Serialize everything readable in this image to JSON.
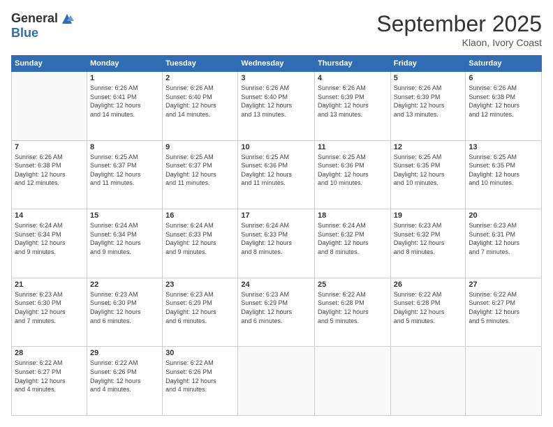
{
  "logo": {
    "general": "General",
    "blue": "Blue"
  },
  "header": {
    "month": "September 2025",
    "location": "Klaon, Ivory Coast"
  },
  "days_of_week": [
    "Sunday",
    "Monday",
    "Tuesday",
    "Wednesday",
    "Thursday",
    "Friday",
    "Saturday"
  ],
  "weeks": [
    [
      {
        "day": "",
        "info": ""
      },
      {
        "day": "1",
        "info": "Sunrise: 6:26 AM\nSunset: 6:41 PM\nDaylight: 12 hours\nand 14 minutes."
      },
      {
        "day": "2",
        "info": "Sunrise: 6:26 AM\nSunset: 6:40 PM\nDaylight: 12 hours\nand 14 minutes."
      },
      {
        "day": "3",
        "info": "Sunrise: 6:26 AM\nSunset: 6:40 PM\nDaylight: 12 hours\nand 13 minutes."
      },
      {
        "day": "4",
        "info": "Sunrise: 6:26 AM\nSunset: 6:39 PM\nDaylight: 12 hours\nand 13 minutes."
      },
      {
        "day": "5",
        "info": "Sunrise: 6:26 AM\nSunset: 6:39 PM\nDaylight: 12 hours\nand 13 minutes."
      },
      {
        "day": "6",
        "info": "Sunrise: 6:26 AM\nSunset: 6:38 PM\nDaylight: 12 hours\nand 12 minutes."
      }
    ],
    [
      {
        "day": "7",
        "info": "Sunrise: 6:26 AM\nSunset: 6:38 PM\nDaylight: 12 hours\nand 12 minutes."
      },
      {
        "day": "8",
        "info": "Sunrise: 6:25 AM\nSunset: 6:37 PM\nDaylight: 12 hours\nand 11 minutes."
      },
      {
        "day": "9",
        "info": "Sunrise: 6:25 AM\nSunset: 6:37 PM\nDaylight: 12 hours\nand 11 minutes."
      },
      {
        "day": "10",
        "info": "Sunrise: 6:25 AM\nSunset: 6:36 PM\nDaylight: 12 hours\nand 11 minutes."
      },
      {
        "day": "11",
        "info": "Sunrise: 6:25 AM\nSunset: 6:36 PM\nDaylight: 12 hours\nand 10 minutes."
      },
      {
        "day": "12",
        "info": "Sunrise: 6:25 AM\nSunset: 6:35 PM\nDaylight: 12 hours\nand 10 minutes."
      },
      {
        "day": "13",
        "info": "Sunrise: 6:25 AM\nSunset: 6:35 PM\nDaylight: 12 hours\nand 10 minutes."
      }
    ],
    [
      {
        "day": "14",
        "info": "Sunrise: 6:24 AM\nSunset: 6:34 PM\nDaylight: 12 hours\nand 9 minutes."
      },
      {
        "day": "15",
        "info": "Sunrise: 6:24 AM\nSunset: 6:34 PM\nDaylight: 12 hours\nand 9 minutes."
      },
      {
        "day": "16",
        "info": "Sunrise: 6:24 AM\nSunset: 6:33 PM\nDaylight: 12 hours\nand 9 minutes."
      },
      {
        "day": "17",
        "info": "Sunrise: 6:24 AM\nSunset: 6:33 PM\nDaylight: 12 hours\nand 8 minutes."
      },
      {
        "day": "18",
        "info": "Sunrise: 6:24 AM\nSunset: 6:32 PM\nDaylight: 12 hours\nand 8 minutes."
      },
      {
        "day": "19",
        "info": "Sunrise: 6:23 AM\nSunset: 6:32 PM\nDaylight: 12 hours\nand 8 minutes."
      },
      {
        "day": "20",
        "info": "Sunrise: 6:23 AM\nSunset: 6:31 PM\nDaylight: 12 hours\nand 7 minutes."
      }
    ],
    [
      {
        "day": "21",
        "info": "Sunrise: 6:23 AM\nSunset: 6:30 PM\nDaylight: 12 hours\nand 7 minutes."
      },
      {
        "day": "22",
        "info": "Sunrise: 6:23 AM\nSunset: 6:30 PM\nDaylight: 12 hours\nand 6 minutes."
      },
      {
        "day": "23",
        "info": "Sunrise: 6:23 AM\nSunset: 6:29 PM\nDaylight: 12 hours\nand 6 minutes."
      },
      {
        "day": "24",
        "info": "Sunrise: 6:23 AM\nSunset: 6:29 PM\nDaylight: 12 hours\nand 6 minutes."
      },
      {
        "day": "25",
        "info": "Sunrise: 6:22 AM\nSunset: 6:28 PM\nDaylight: 12 hours\nand 5 minutes."
      },
      {
        "day": "26",
        "info": "Sunrise: 6:22 AM\nSunset: 6:28 PM\nDaylight: 12 hours\nand 5 minutes."
      },
      {
        "day": "27",
        "info": "Sunrise: 6:22 AM\nSunset: 6:27 PM\nDaylight: 12 hours\nand 5 minutes."
      }
    ],
    [
      {
        "day": "28",
        "info": "Sunrise: 6:22 AM\nSunset: 6:27 PM\nDaylight: 12 hours\nand 4 minutes."
      },
      {
        "day": "29",
        "info": "Sunrise: 6:22 AM\nSunset: 6:26 PM\nDaylight: 12 hours\nand 4 minutes."
      },
      {
        "day": "30",
        "info": "Sunrise: 6:22 AM\nSunset: 6:26 PM\nDaylight: 12 hours\nand 4 minutes."
      },
      {
        "day": "",
        "info": ""
      },
      {
        "day": "",
        "info": ""
      },
      {
        "day": "",
        "info": ""
      },
      {
        "day": "",
        "info": ""
      }
    ]
  ]
}
